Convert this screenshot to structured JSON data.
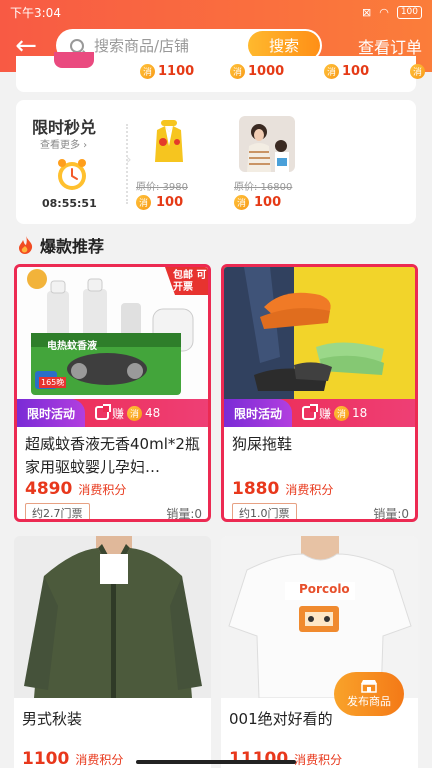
{
  "status": {
    "time": "下午3:04",
    "battery": "100"
  },
  "header": {
    "search_placeholder": "搜索商品/店铺",
    "search_btn": "搜索",
    "orders": "查看订单"
  },
  "top_row": {
    "prices": [
      "1100",
      "1000",
      "100"
    ],
    "xiao": "消"
  },
  "flash_sale": {
    "title": "限时秒兑",
    "more": "查看更多",
    "countdown": "08:55:51",
    "items": [
      {
        "orig": "原价: 3980",
        "price": "100"
      },
      {
        "orig": "原价: 16800",
        "price": "100"
      }
    ]
  },
  "section": {
    "title": "爆款推荐"
  },
  "products": [
    {
      "name": "超威蚊香液无香40ml*2瓶家用驱蚊婴儿孕妇…",
      "promo": "限时活动",
      "earn": "赚",
      "earn_amount": "48",
      "price": "4890",
      "price_unit": "消费积分",
      "ticket": "约2.7门票",
      "sales": "销量:0",
      "badge": "包邮 可开票",
      "box_text": "电热蚊香液",
      "box_count": "165晚"
    },
    {
      "name": "狗屎拖鞋",
      "promo": "限时活动",
      "earn": "赚",
      "earn_amount": "18",
      "price": "1880",
      "price_unit": "消费积分",
      "ticket": "约1.0门票",
      "sales": "销量:0"
    },
    {
      "name": "男式秋装",
      "price": "1100",
      "price_unit": "消费积分"
    },
    {
      "name": "001绝对好看的",
      "price": "11100",
      "price_unit": "消费积分",
      "shirt_text": "Porcolo"
    }
  ],
  "publish": {
    "label": "发布商品"
  },
  "colors": {
    "brand": "#f85a44",
    "accent": "#ff8f16",
    "price": "#e8381c",
    "promo_red": "#ec2a52"
  }
}
